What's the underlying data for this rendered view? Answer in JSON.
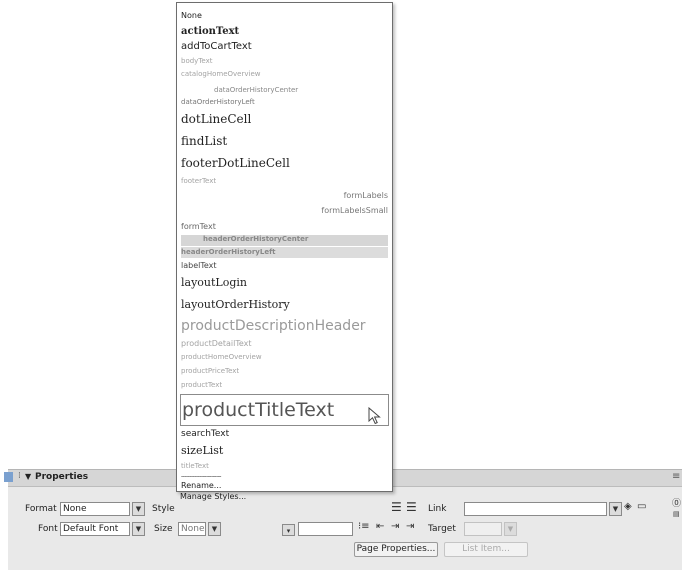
{
  "style_menu": {
    "items": [
      {
        "label": "None"
      },
      {
        "label": "actionText"
      },
      {
        "label": "addToCartText"
      },
      {
        "label": "bodyText"
      },
      {
        "label": "catalogHomeOverview"
      },
      {
        "label": "dataOrderHistoryCenter"
      },
      {
        "label": "dataOrderHistoryLeft"
      },
      {
        "label": "dotLineCell"
      },
      {
        "label": "findList"
      },
      {
        "label": "footerDotLineCell"
      },
      {
        "label": "footerText"
      },
      {
        "label": "formLabels"
      },
      {
        "label": "formLabelsSmall"
      },
      {
        "label": "formText"
      },
      {
        "label": "headerOrderHistoryCenter"
      },
      {
        "label": "headerOrderHistoryLeft"
      },
      {
        "label": "labelText"
      },
      {
        "label": "layoutLogin"
      },
      {
        "label": "layoutOrderHistory"
      },
      {
        "label": "productDescriptionHeader"
      },
      {
        "label": "productDetailText"
      },
      {
        "label": "productHomeOverview"
      },
      {
        "label": "productPriceText"
      },
      {
        "label": "productText"
      },
      {
        "label": "productTitleText"
      },
      {
        "label": "searchText"
      },
      {
        "label": "sizeList"
      },
      {
        "label": "titleText"
      }
    ],
    "separator": "------------------------",
    "rename_label": "Rename...",
    "manage_label": "Manage Styles..."
  },
  "properties": {
    "title": "Properties",
    "format_label": "Format",
    "format_value": "None",
    "style_label": "Style",
    "font_label": "Font",
    "font_value": "Default Font",
    "size_label": "Size",
    "size_value": "None",
    "link_label": "Link",
    "link_value": "",
    "target_label": "Target",
    "target_value": "",
    "page_properties_label": "Page Properties...",
    "list_item_label": "List Item..."
  }
}
